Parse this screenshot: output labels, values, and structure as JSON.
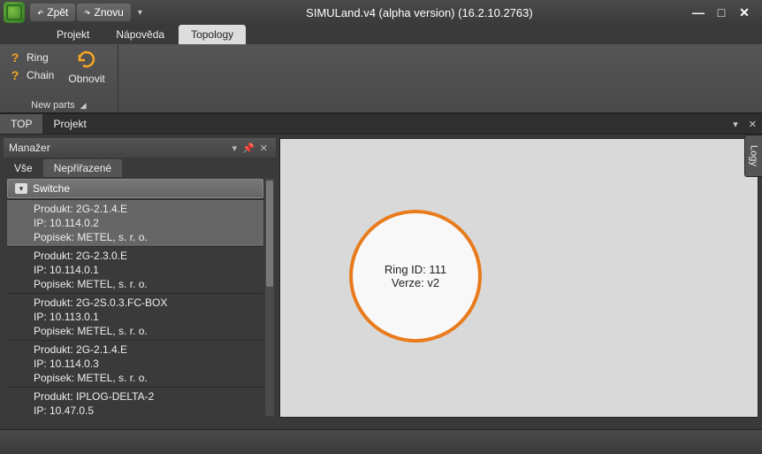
{
  "title": "SIMULand.v4 (alpha version) (16.2.10.2763)",
  "qat": {
    "back": "Zpět",
    "forward": "Znovu"
  },
  "menu": {
    "projekt": "Projekt",
    "napoveda": "Nápověda",
    "topology": "Topology"
  },
  "ribbon": {
    "ring": "Ring",
    "chain": "Chain",
    "obnovit": "Obnovit",
    "group_label": "New parts"
  },
  "doc_tabs": {
    "top": "TOP",
    "projekt": "Projekt"
  },
  "manager": {
    "title": "Manažer",
    "tab_all": "Vše",
    "tab_unassigned": "Nepřiřazené",
    "group": "Switche",
    "items": [
      {
        "produkt": "Produkt: 2G-2.1.4.E",
        "ip": "IP: 10.114.0.2",
        "popisek": "Popisek: METEL, s. r. o."
      },
      {
        "produkt": "Produkt: 2G-2.3.0.E",
        "ip": "IP: 10.114.0.1",
        "popisek": "Popisek: METEL, s. r. o."
      },
      {
        "produkt": "Produkt: 2G-2S.0.3.FC-BOX",
        "ip": "IP: 10.113.0.1",
        "popisek": "Popisek: METEL, s. r. o."
      },
      {
        "produkt": "Produkt: 2G-2.1.4.E",
        "ip": "IP: 10.114.0.3",
        "popisek": "Popisek: METEL, s. r. o."
      },
      {
        "produkt": "Produkt: IPLOG-DELTA-2",
        "ip": "IP: 10.47.0.5",
        "popisek": ""
      }
    ]
  },
  "canvas": {
    "ring_id_label": "Ring ID: 111",
    "verze_label": "Verze: v2"
  },
  "side_tab": "Logy"
}
